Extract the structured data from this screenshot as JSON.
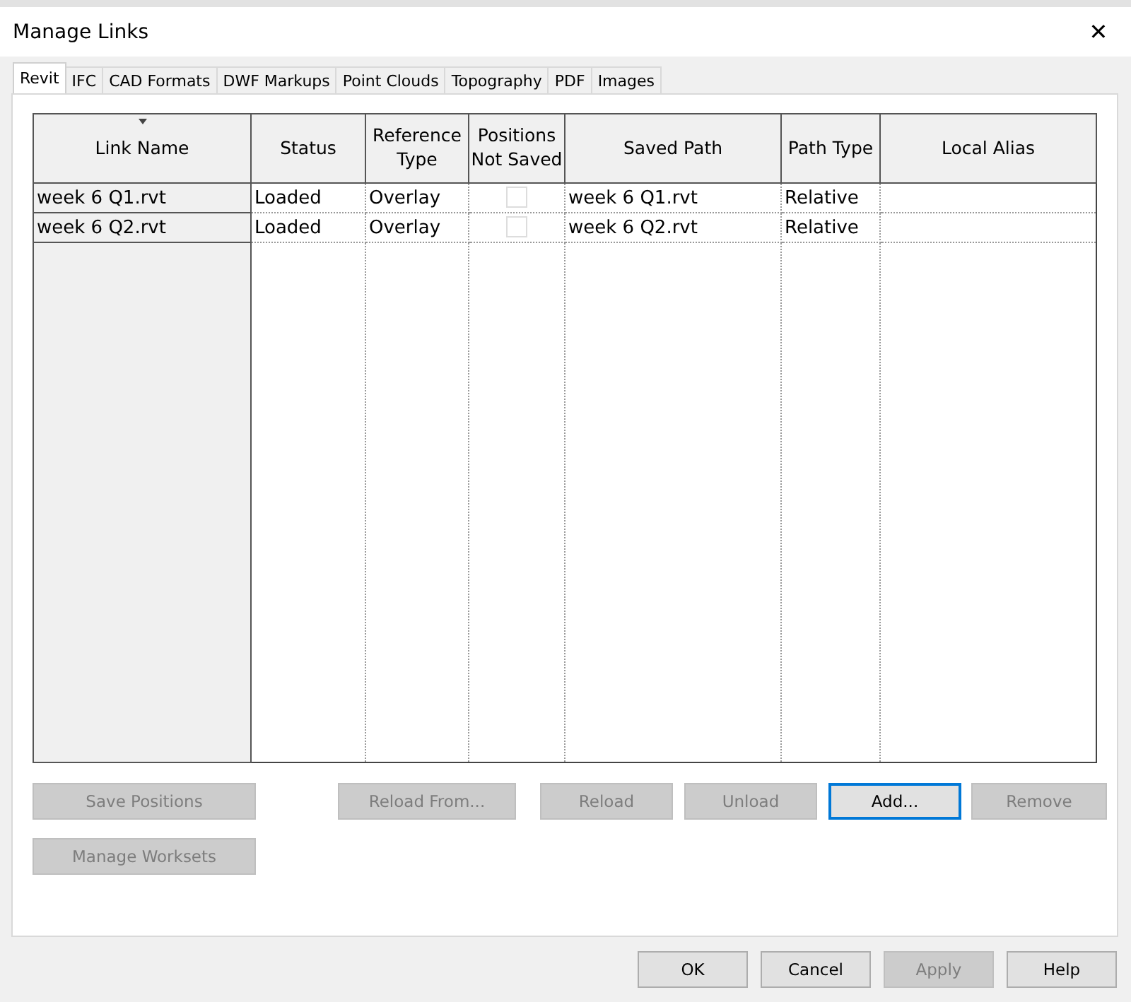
{
  "window": {
    "title": "Manage Links",
    "close": "✕"
  },
  "tabs": [
    {
      "label": "Revit",
      "selected": true
    },
    {
      "label": "IFC",
      "selected": false
    },
    {
      "label": "CAD Formats",
      "selected": false
    },
    {
      "label": "DWF Markups",
      "selected": false
    },
    {
      "label": "Point Clouds",
      "selected": false
    },
    {
      "label": "Topography",
      "selected": false
    },
    {
      "label": "PDF",
      "selected": false
    },
    {
      "label": "Images",
      "selected": false
    }
  ],
  "table": {
    "columns": [
      {
        "label": "Link Name",
        "sorted": true
      },
      {
        "label": "Status",
        "sorted": false
      },
      {
        "label": "Reference Type",
        "sorted": false
      },
      {
        "label": "Positions Not Saved",
        "sorted": false
      },
      {
        "label": "Saved Path",
        "sorted": false
      },
      {
        "label": "Path Type",
        "sorted": false
      },
      {
        "label": "Local Alias",
        "sorted": false
      }
    ],
    "rows": [
      {
        "link_name": "week 6 Q1.rvt",
        "status": "Loaded",
        "reference_type": "Overlay",
        "positions_not_saved": false,
        "saved_path": "week 6 Q1.rvt",
        "path_type": "Relative"
      },
      {
        "link_name": "week 6 Q2.rvt",
        "status": "Loaded",
        "reference_type": "Overlay",
        "positions_not_saved": false,
        "saved_path": "week 6 Q2.rvt",
        "path_type": "Relative"
      }
    ]
  },
  "left_buttons": [
    {
      "label": "Save Positions",
      "disabled": true
    },
    {
      "label": "Manage Worksets",
      "disabled": true
    }
  ],
  "action_buttons": [
    {
      "label": "Reload From...",
      "disabled": true,
      "focused": false
    },
    {
      "label": "Reload",
      "disabled": true,
      "focused": false
    },
    {
      "label": "Unload",
      "disabled": true,
      "focused": false
    },
    {
      "label": "Add...",
      "disabled": false,
      "focused": true
    },
    {
      "label": "Remove",
      "disabled": true,
      "focused": false
    }
  ],
  "dialog_buttons": [
    {
      "label": "OK",
      "disabled": false
    },
    {
      "label": "Cancel",
      "disabled": false
    },
    {
      "label": "Apply",
      "disabled": true
    },
    {
      "label": "Help",
      "disabled": false
    }
  ]
}
